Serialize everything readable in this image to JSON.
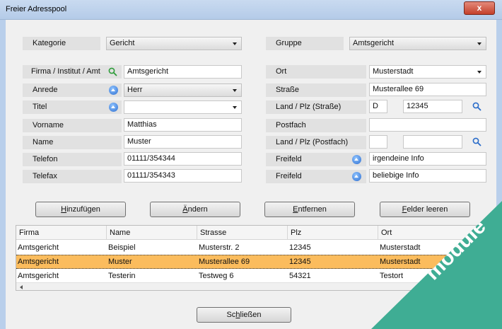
{
  "window": {
    "title": "Freier Adresspool",
    "close_glyph": "x"
  },
  "form": {
    "kategorie": {
      "label": "Kategorie",
      "value": "Gericht"
    },
    "gruppe": {
      "label": "Gruppe",
      "value": "Amtsgericht"
    },
    "left": [
      {
        "label": "Firma / Institut / Amt",
        "value": "Amtsgericht"
      },
      {
        "label": "Anrede",
        "value": "Herr"
      },
      {
        "label": "Titel",
        "value": ""
      },
      {
        "label": "Vorname",
        "value": "Matthias"
      },
      {
        "label": "Name",
        "value": "Muster"
      },
      {
        "label": "Telefon",
        "value": "01111/354344"
      },
      {
        "label": "Telefax",
        "value": "01111/354343"
      }
    ],
    "right": [
      {
        "label": "Ort",
        "value": "Musterstadt"
      },
      {
        "label": "Straße",
        "value": "Musterallee 69"
      },
      {
        "label": "Land / Plz (Straße)",
        "land": "D",
        "plz": "12345"
      },
      {
        "label": "Postfach",
        "value": ""
      },
      {
        "label": "Land / Plz (Postfach)",
        "land": "",
        "plz": ""
      },
      {
        "label": "Freifeld",
        "value": "irgendeine Info"
      },
      {
        "label": "Freifeld",
        "value": "beliebige Info"
      }
    ]
  },
  "buttons": {
    "add": {
      "u": "H",
      "rest": "inzufügen"
    },
    "edit": {
      "u": "Ä",
      "rest": "ndern"
    },
    "remove": {
      "u": "E",
      "rest": "ntfernen"
    },
    "clear": {
      "u": "F",
      "rest": "elder leeren"
    },
    "close": {
      "pre": "Sc",
      "u": "h",
      "rest": "ließen"
    }
  },
  "table": {
    "columns": [
      "Firma",
      "Name",
      "Strasse",
      "Plz",
      "Ort"
    ],
    "rows": [
      [
        "Amtsgericht",
        "Beispiel",
        "Musterstr. 2",
        "12345",
        "Musterstadt"
      ],
      [
        "Amtsgericht",
        "Muster",
        "Musterallee 69",
        "12345",
        "Musterstadt"
      ],
      [
        "Amtsgericht",
        "Testerin",
        "Testweg 6",
        "54321",
        "Testort"
      ]
    ],
    "selected_row": 1
  },
  "watermark": {
    "text": "module"
  },
  "icons": {
    "search": "magnifier-icon",
    "info": "info-bulb-icon"
  },
  "colors": {
    "selection": "#fbbc5d",
    "watermark": "#3fad94",
    "close": "#c4402b"
  }
}
